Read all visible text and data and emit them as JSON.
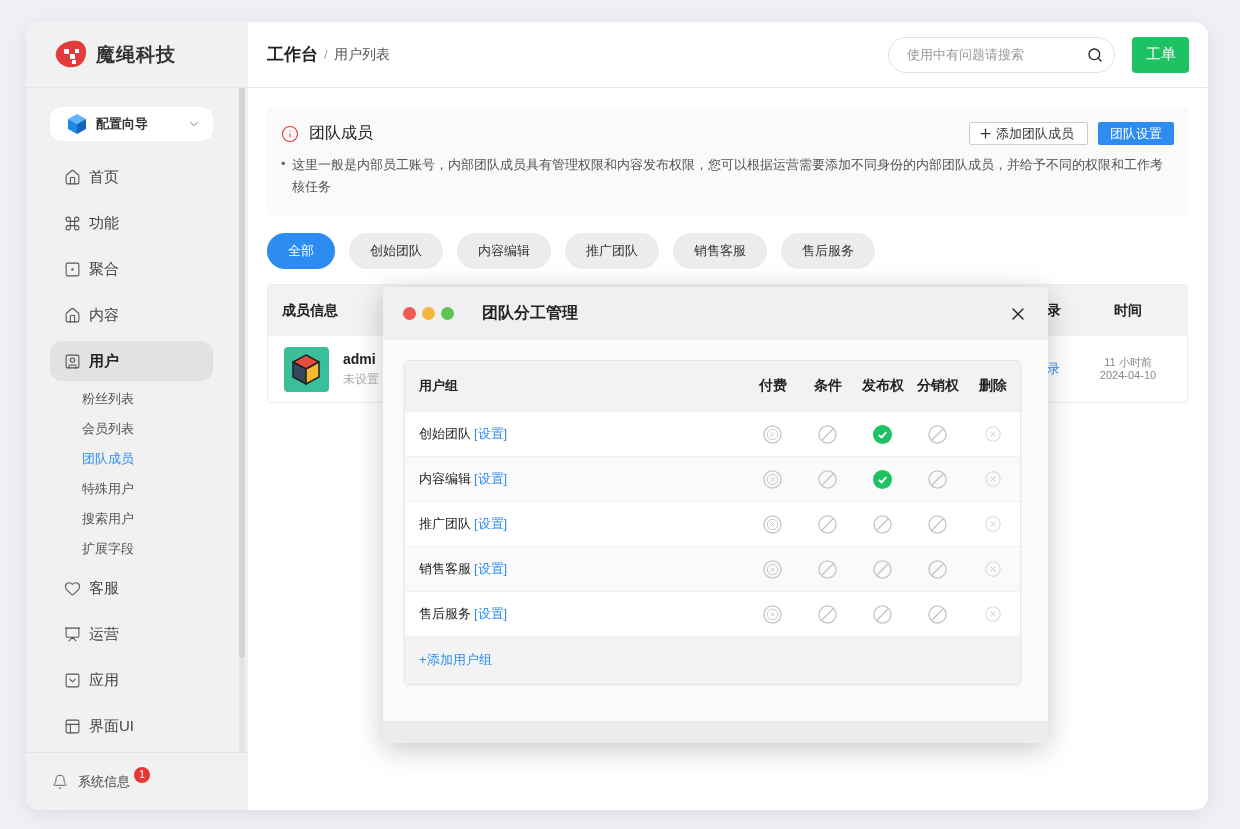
{
  "brand": {
    "name": "魔绳科技"
  },
  "guide": {
    "label": "配置向导"
  },
  "nav": [
    {
      "label": "首页",
      "selected": false
    },
    {
      "label": "功能",
      "selected": false
    },
    {
      "label": "聚合",
      "selected": false
    },
    {
      "label": "内容",
      "selected": false
    },
    {
      "label": "用户",
      "selected": true,
      "expanded": true,
      "children": [
        {
          "label": "粉丝列表",
          "selected": false
        },
        {
          "label": "会员列表",
          "selected": false
        },
        {
          "label": "团队成员",
          "selected": true
        },
        {
          "label": "特殊用户",
          "selected": false
        },
        {
          "label": "搜索用户",
          "selected": false
        },
        {
          "label": "扩展字段",
          "selected": false
        }
      ]
    },
    {
      "label": "客服",
      "selected": false
    },
    {
      "label": "运营",
      "selected": false
    },
    {
      "label": "应用",
      "selected": false
    },
    {
      "label": "界面UI",
      "selected": false
    }
  ],
  "notification": {
    "label": "系统信息",
    "badge": "1"
  },
  "header": {
    "title": "工作台",
    "separator": "/",
    "page": "用户列表"
  },
  "search": {
    "placeholder": "使用中有问题请搜索"
  },
  "ticket_button": "工单",
  "notice": {
    "title": "团队成员",
    "add_button": "添加团队成员",
    "settings_button": "团队设置",
    "bullet_marker": "•",
    "bullets": [
      "这里一般是内部员工账号，内部团队成员具有管理权限和内容发布权限，您可以根据运营需要添加不同身份的内部团队成员，并给予不同的权限和工作考核任务"
    ]
  },
  "filters": [
    {
      "label": "全部",
      "selected": true
    },
    {
      "label": "创始团队",
      "selected": false
    },
    {
      "label": "内容编辑",
      "selected": false
    },
    {
      "label": "推广团队",
      "selected": false
    },
    {
      "label": "销售客服",
      "selected": false
    },
    {
      "label": "售后服务",
      "selected": false
    }
  ],
  "members_table": {
    "columns": [
      "成员信息",
      "录",
      "时间"
    ],
    "rows": [
      {
        "name": "admi",
        "subtitle": "未设置",
        "link": "录",
        "time": "11 小时前",
        "date": "2024-04-10"
      }
    ]
  },
  "dialog": {
    "title": "团队分工管理",
    "columns": [
      "用户组",
      "付费",
      "条件",
      "发布权",
      "分销权",
      "删除"
    ],
    "rows": [
      {
        "name": "创始团队",
        "link": "[设置]",
        "permissions": [
          false,
          false,
          true,
          false
        ]
      },
      {
        "name": "内容编辑",
        "link": "[设置]",
        "permissions": [
          false,
          false,
          true,
          false
        ]
      },
      {
        "name": "推广团队",
        "link": "[设置]",
        "permissions": [
          false,
          false,
          false,
          false
        ]
      },
      {
        "name": "销售客服",
        "link": "[设置]",
        "permissions": [
          false,
          false,
          false,
          false
        ]
      },
      {
        "name": "售后服务",
        "link": "[设置]",
        "permissions": [
          false,
          false,
          false,
          false
        ]
      }
    ],
    "add_link": "+添加用户组"
  }
}
